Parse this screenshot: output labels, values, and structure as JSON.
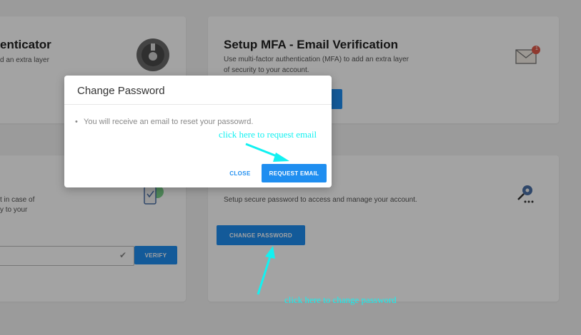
{
  "cards": {
    "authenticator": {
      "title": "enticator",
      "desc_line1": "d an extra layer"
    },
    "email_mfa": {
      "title": "Setup MFA - Email Verification",
      "desc_line1": "Use multi-factor authentication (MFA) to add an extra layer",
      "desc_line2": "of security to your account.",
      "badge": "1"
    },
    "recovery": {
      "desc_line1": "t in case of",
      "desc_line2": "y to your",
      "verify_label": "VERIFY"
    },
    "password": {
      "desc": "Setup secure password to access and manage your account.",
      "button_label": "CHANGE PASSWORD"
    }
  },
  "modal": {
    "title": "Change Password",
    "message": "You will receive an email to reset your passowrd.",
    "close_label": "CLOSE",
    "request_label": "REQUEST EMAIL"
  },
  "annotations": {
    "request_email": "click here to request email",
    "change_password": "click here to change password"
  },
  "colors": {
    "accent": "#1f8ef0",
    "annotation": "#13f1f1"
  }
}
